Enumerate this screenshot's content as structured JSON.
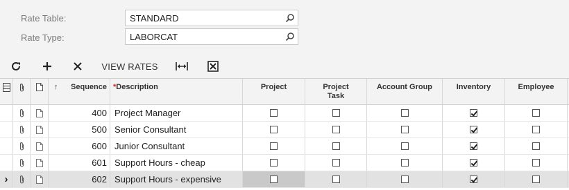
{
  "form": {
    "rate_table_label": "Rate Table:",
    "rate_table_value": "STANDARD",
    "rate_type_label": "Rate Type:",
    "rate_type_value": "LABORCAT"
  },
  "toolbar": {
    "refresh_icon": "refresh-icon",
    "add_icon": "plus-icon",
    "delete_icon": "x-icon",
    "view_rates_label": "VIEW RATES",
    "fit_icon": "fit-columns-icon",
    "export_icon": "excel-export-icon"
  },
  "grid": {
    "columns": {
      "sort": "↑",
      "sequence": "Sequence",
      "description_req": "*",
      "description": "Description",
      "project": "Project",
      "project_task": "Project Task",
      "account_group": "Account Group",
      "inventory": "Inventory",
      "employee": "Employee"
    },
    "rows": [
      {
        "sequence": "400",
        "description": "Project Manager",
        "project": false,
        "project_task": false,
        "account_group": false,
        "inventory": true,
        "employee": false
      },
      {
        "sequence": "500",
        "description": "Senior Consultant",
        "project": false,
        "project_task": false,
        "account_group": false,
        "inventory": true,
        "employee": false
      },
      {
        "sequence": "600",
        "description": "Junior Consultant",
        "project": false,
        "project_task": false,
        "account_group": false,
        "inventory": true,
        "employee": false
      },
      {
        "sequence": "601",
        "description": "Support Hours - cheap",
        "project": false,
        "project_task": false,
        "account_group": false,
        "inventory": true,
        "employee": false
      },
      {
        "sequence": "602",
        "description": "Support Hours - expensive",
        "project": false,
        "project_task": false,
        "account_group": false,
        "inventory": true,
        "employee": false
      }
    ],
    "active_row_index": 4,
    "active_marker": "›"
  }
}
